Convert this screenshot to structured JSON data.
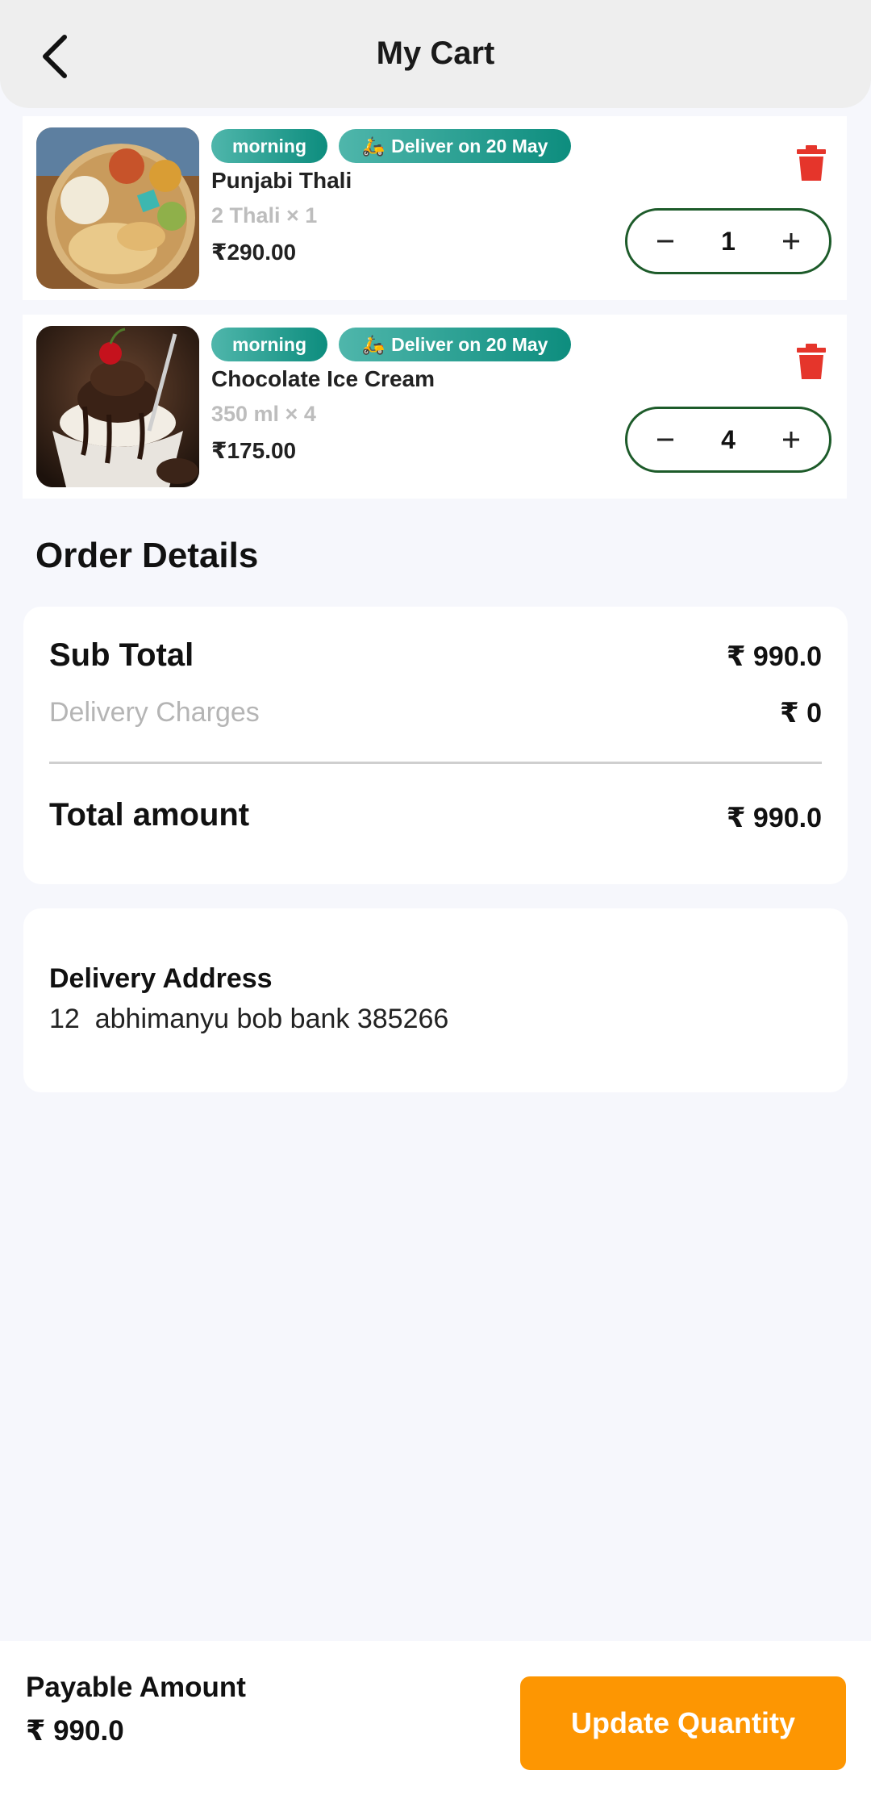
{
  "header": {
    "title": "My Cart"
  },
  "cart": {
    "items": [
      {
        "slot": "morning",
        "deliver_text": "Deliver on 20 May",
        "name": "Punjabi Thali",
        "qty_text": "2 Thali × 1",
        "price": "₹290.00",
        "quantity": "1",
        "image": "thali-photo"
      },
      {
        "slot": "morning",
        "deliver_text": "Deliver on 20 May",
        "name": "Chocolate Ice Cream",
        "qty_text": "350 ml × 4",
        "price": "₹175.00",
        "quantity": "4",
        "image": "ice-cream-photo"
      }
    ]
  },
  "order_details": {
    "title": "Order Details",
    "sub_total_label": "Sub Total",
    "sub_total_value": "₹ 990.0",
    "delivery_label": "Delivery Charges",
    "delivery_value": "₹ 0",
    "total_label": "Total amount",
    "total_value": "₹ 990.0"
  },
  "address": {
    "title": "Delivery Address",
    "text": "12  abhimanyu bob bank 385266"
  },
  "bottom": {
    "payable_label": "Payable Amount",
    "payable_value": "₹ 990.0",
    "button_label": "Update Quantity"
  },
  "colors": {
    "accent": "#fd9602",
    "tag": "#0d8d7e",
    "delete": "#e5352b",
    "stepper_border": "#1d5b2a"
  },
  "icons": {
    "back": "arrow-left-icon",
    "delete": "trash-icon",
    "minus": "minus-icon",
    "plus": "plus-icon",
    "scooter": "scooter-icon"
  }
}
